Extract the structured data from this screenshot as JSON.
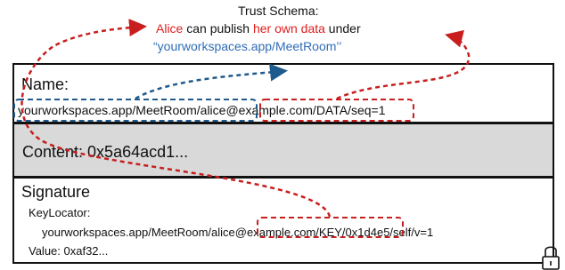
{
  "trust_schema": {
    "title": "Trust Schema:",
    "line1_alice": "Alice",
    "line1_mid": " can publish ",
    "line1_own": "her own data",
    "line1_end": " under",
    "line2": "“yourworkspaces.app/MeetRoom’’"
  },
  "name_box": {
    "label": "Name:",
    "prefix": "yourworkspaces.app/MeetRoom",
    "sep1": "/",
    "identity": "alice@example.com",
    "sep2": "/",
    "suffix": "DATA/seq=1"
  },
  "content_box": {
    "label": "Content: 0x5a64acd1..."
  },
  "signature_box": {
    "label": "Signature",
    "keylocator_label": "KeyLocator:",
    "kl_prefix": "yourworkspaces.app/MeetRoom",
    "kl_sep1": "/",
    "kl_identity": "alice@example.com",
    "kl_sep2": "/",
    "kl_suffix": "KEY/0x1d4e5/self/v=1",
    "value": "Value: 0xaf32..."
  },
  "colors": {
    "red_dash": "#c81e1e",
    "blue_dash": "#1f5a8c",
    "accent_red": "#e11d1d",
    "accent_blue": "#2f6db5",
    "content_fill": "#d9d9d9"
  },
  "icons": {
    "lock": "lock-icon"
  }
}
